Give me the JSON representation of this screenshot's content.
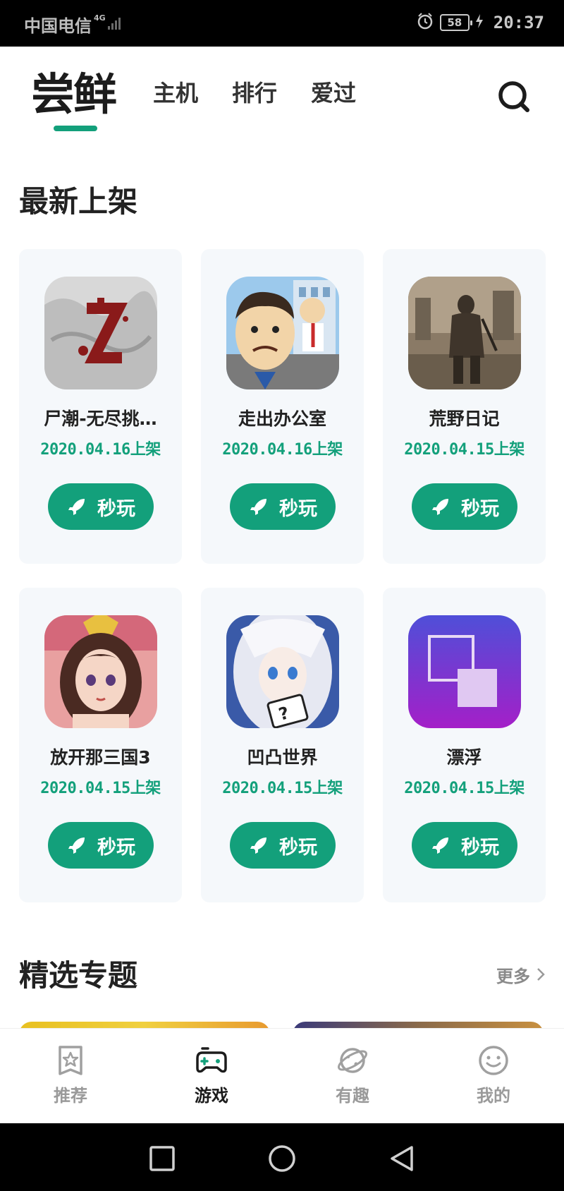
{
  "status_bar": {
    "carrier": "中国电信",
    "network": "4G",
    "battery": "58",
    "time": "20:37"
  },
  "header": {
    "brand": "尝鲜",
    "tabs": [
      {
        "label": "主机"
      },
      {
        "label": "排行"
      },
      {
        "label": "爱过"
      }
    ]
  },
  "new_arrivals": {
    "title": "最新上架",
    "play_label": "秒玩",
    "games": [
      {
        "name": "尸潮-无尽挑…",
        "date": "2020.04.16上架"
      },
      {
        "name": "走出办公室",
        "date": "2020.04.16上架"
      },
      {
        "name": "荒野日记",
        "date": "2020.04.15上架"
      },
      {
        "name": "放开那三国3",
        "date": "2020.04.15上架"
      },
      {
        "name": "凹凸世界",
        "date": "2020.04.15上架"
      },
      {
        "name": "漂浮",
        "date": "2020.04.15上架"
      }
    ]
  },
  "featured": {
    "title": "精选专题",
    "more_label": "更多"
  },
  "bottom_nav": {
    "items": [
      {
        "label": "推荐",
        "icon": "star-icon"
      },
      {
        "label": "游戏",
        "icon": "gamepad-icon",
        "active": true
      },
      {
        "label": "有趣",
        "icon": "planet-icon"
      },
      {
        "label": "我的",
        "icon": "smiley-icon"
      }
    ]
  },
  "colors": {
    "accent": "#13a07b",
    "card_bg": "#f5f8fb",
    "text_primary": "#222222",
    "text_muted": "#9a9a9a"
  }
}
